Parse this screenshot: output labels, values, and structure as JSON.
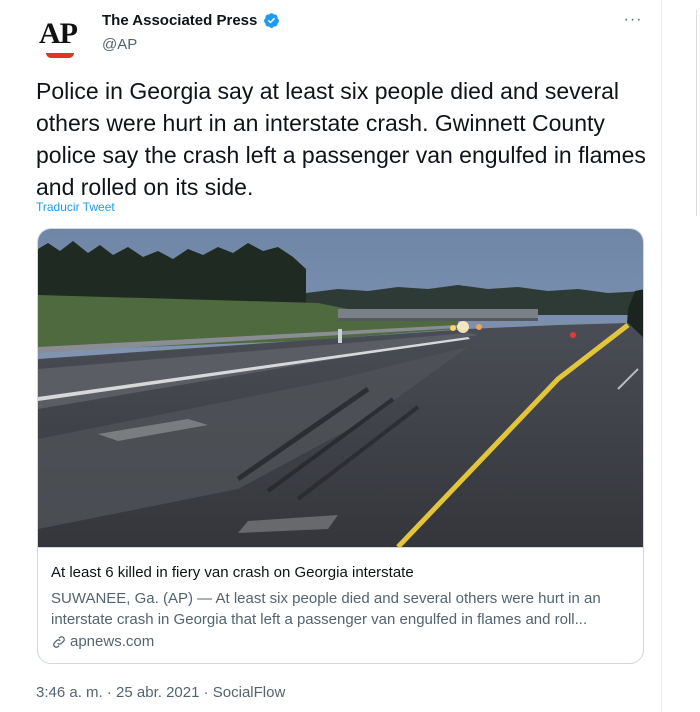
{
  "account": {
    "name": "The Associated Press",
    "handle": "@AP",
    "avatar_text": "AP",
    "avatar_accent": "#e0342b",
    "verified": true,
    "verified_color": "#1d9bf0",
    "verified_icon": "verified-badge-icon",
    "more_icon": "more-options-icon",
    "more_label": "···"
  },
  "tweet": {
    "text": "Police in Georgia say at least six people died and several others were hurt in an interstate crash. Gwinnett County police say the crash left a passenger van engulfed in flames and rolled on its side.",
    "translate_label": "Traducir Tweet",
    "link_color": "#1d9bf0"
  },
  "card": {
    "image_description_icon": "photo-highway-crash-scene",
    "title": "At least 6 killed in fiery van crash on Georgia interstate",
    "description": "SUWANEE, Ga. (AP) — At least six people died and several others were hurt in an interstate crash in Georgia that left a passenger van engulfed in flames and roll...",
    "domain": "apnews.com",
    "domain_icon": "link-icon"
  },
  "meta": {
    "timestamp": "3:46 a. m. · 25 abr. 2021 · SocialFlow"
  }
}
